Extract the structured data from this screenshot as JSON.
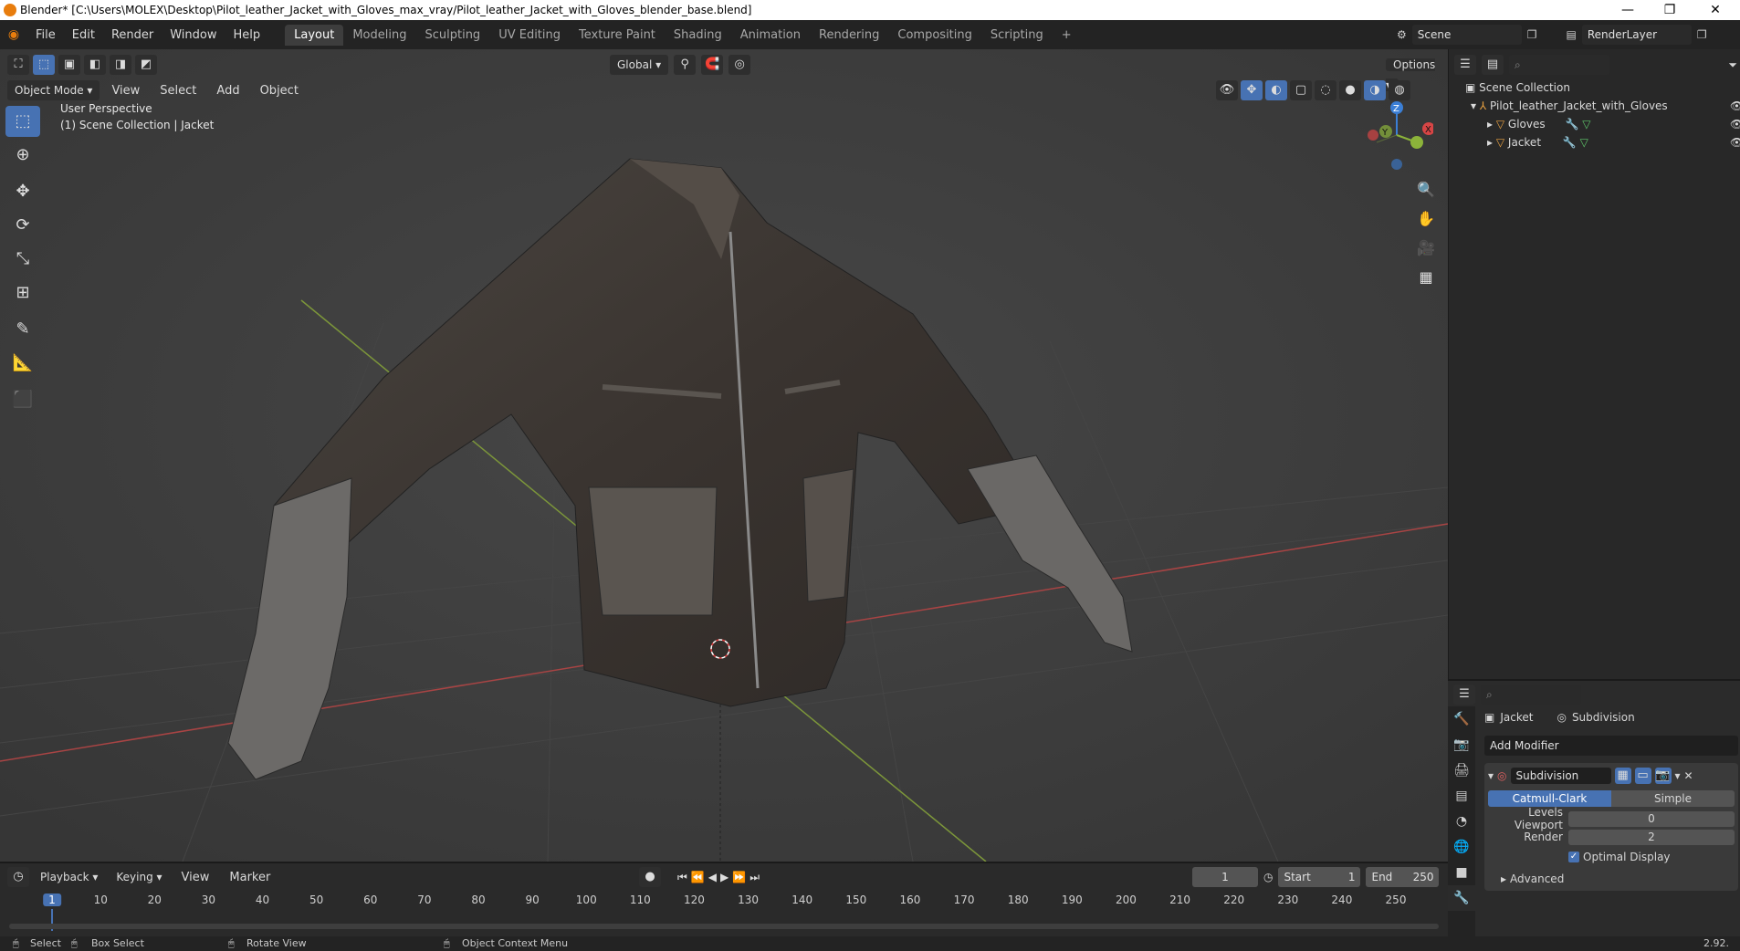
{
  "window": {
    "title": "Blender* [C:\\Users\\MOLEX\\Desktop\\Pilot_leather_Jacket_with_Gloves_max_vray/Pilot_leather_Jacket_with_Gloves_blender_base.blend]",
    "minimize": "—",
    "maximize": "❐",
    "close": "✕"
  },
  "menu": [
    "File",
    "Edit",
    "Render",
    "Window",
    "Help"
  ],
  "workspaces": [
    "Layout",
    "Modeling",
    "Sculpting",
    "UV Editing",
    "Texture Paint",
    "Shading",
    "Animation",
    "Rendering",
    "Compositing",
    "Scripting"
  ],
  "add_workspace": "+",
  "scene": "Scene",
  "view_layer": "RenderLayer",
  "viewport": {
    "mode": "Object Mode",
    "menus": [
      "View",
      "Select",
      "Add",
      "Object"
    ],
    "orientation": "Global",
    "options": "Options",
    "overlay_line1": "User Perspective",
    "overlay_line2": "(1) Scene Collection | Jacket",
    "gizmo": {
      "z": "Z",
      "y": "Y",
      "x": "X"
    }
  },
  "outliner": {
    "root": "Scene Collection",
    "collection": "Pilot_leather_Jacket_with_Gloves",
    "items": [
      "Gloves",
      "Jacket"
    ]
  },
  "properties": {
    "object": "Jacket",
    "modifier_context": "Subdivision",
    "add_modifier": "Add Modifier",
    "modifier_name": "Subdivision",
    "algo_options": [
      "Catmull-Clark",
      "Simple"
    ],
    "levels_viewport_label": "Levels Viewport",
    "levels_viewport": "0",
    "render_label": "Render",
    "render_value": "2",
    "optimal_display": "Optimal Display",
    "advanced": "Advanced"
  },
  "timeline": {
    "menus": [
      "Playback",
      "Keying",
      "View",
      "Marker"
    ],
    "current_frame": "1",
    "start_label": "Start",
    "start": "1",
    "end_label": "End",
    "end": "250",
    "ticks": [
      "1",
      "10",
      "20",
      "30",
      "40",
      "50",
      "60",
      "70",
      "80",
      "90",
      "100",
      "110",
      "120",
      "130",
      "140",
      "150",
      "160",
      "170",
      "180",
      "190",
      "200",
      "210",
      "220",
      "230",
      "240",
      "250"
    ]
  },
  "status": {
    "select": "Select",
    "box_select": "Box Select",
    "rotate_view": "Rotate View",
    "context_menu": "Object Context Menu",
    "version": "2.92."
  },
  "colors": {
    "accent": "#4772b3",
    "x_axis": "#d64545",
    "y_axis": "#8cb33a",
    "z_axis": "#3b7fd6"
  }
}
